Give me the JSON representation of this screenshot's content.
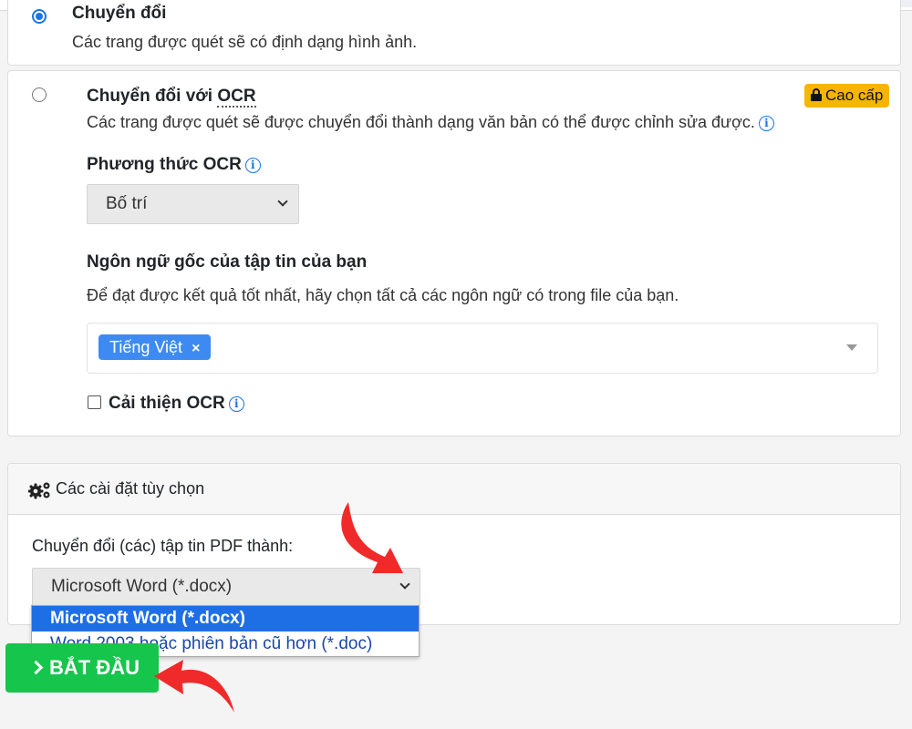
{
  "conversion": {
    "option1": {
      "title": "Chuyển đổi",
      "description": "Các trang được quét sẽ có định dạng hình ảnh.",
      "selected": true
    },
    "option2": {
      "title_prefix": "Chuyển đổi với ",
      "title_ocr": "OCR",
      "description": "Các trang được quét sẽ được chuyển đổi thành dạng văn bản có thể được chỉnh sửa được.",
      "badge": "Cao cấp",
      "selected": false,
      "ocr_method": {
        "label": "Phương thức OCR",
        "value": "Bố trí"
      },
      "source_language": {
        "label": "Ngôn ngữ gốc của tập tin của bạn",
        "hint": "Để đạt được kết quả tốt nhất, hãy chọn tất cả các ngôn ngữ có trong file của bạn.",
        "tags": [
          "Tiếng Việt"
        ],
        "remove_symbol": "×"
      },
      "improve_ocr": {
        "label": "Cải thiện OCR",
        "checked": false
      }
    }
  },
  "optional_settings": {
    "header": "Các cài đặt tùy chọn",
    "convert_label": "Chuyển đổi (các) tập tin PDF thành:",
    "selected_format": "Microsoft Word (*.docx)",
    "options": [
      "Microsoft Word (*.docx)",
      "Word 2003 hoặc phiên bản cũ hơn (*.doc)"
    ]
  },
  "start_button": {
    "label": "BẮT ĐẦU"
  },
  "colors": {
    "accent": "#1a73e8",
    "start_green": "#16c54c",
    "premium_yellow": "#f7b500",
    "annotation_red": "#f02a2a"
  }
}
